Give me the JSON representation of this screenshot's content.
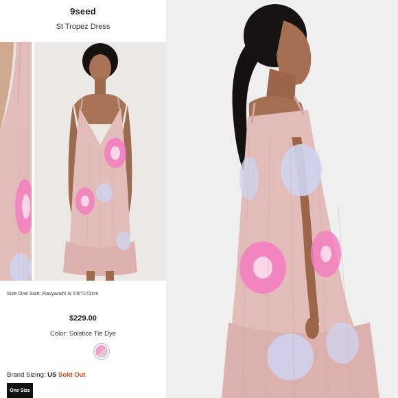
{
  "product": {
    "brand": "9seed",
    "name": "St Tropez Dress",
    "size_note": "Size One Size: Ravyanshi is 5'8\"/172cm",
    "price": "$229.00",
    "color_label": "Color: Solstice Tie Dye",
    "brand_sizing_prefix": "Brand Sizing:",
    "brand_sizing_region": "US",
    "availability": "Sold Out",
    "size_option": "One Size"
  },
  "colors": {
    "dress": "#e2bcb8",
    "tie_dye_pink": "#f47bbf",
    "tie_dye_blue": "#cfd3ee",
    "sold_out": "#d04b1b"
  },
  "images": {
    "left_crop": "dress-closeup-photo",
    "left_main": "model-front-photo",
    "hero": "model-side-photo"
  }
}
